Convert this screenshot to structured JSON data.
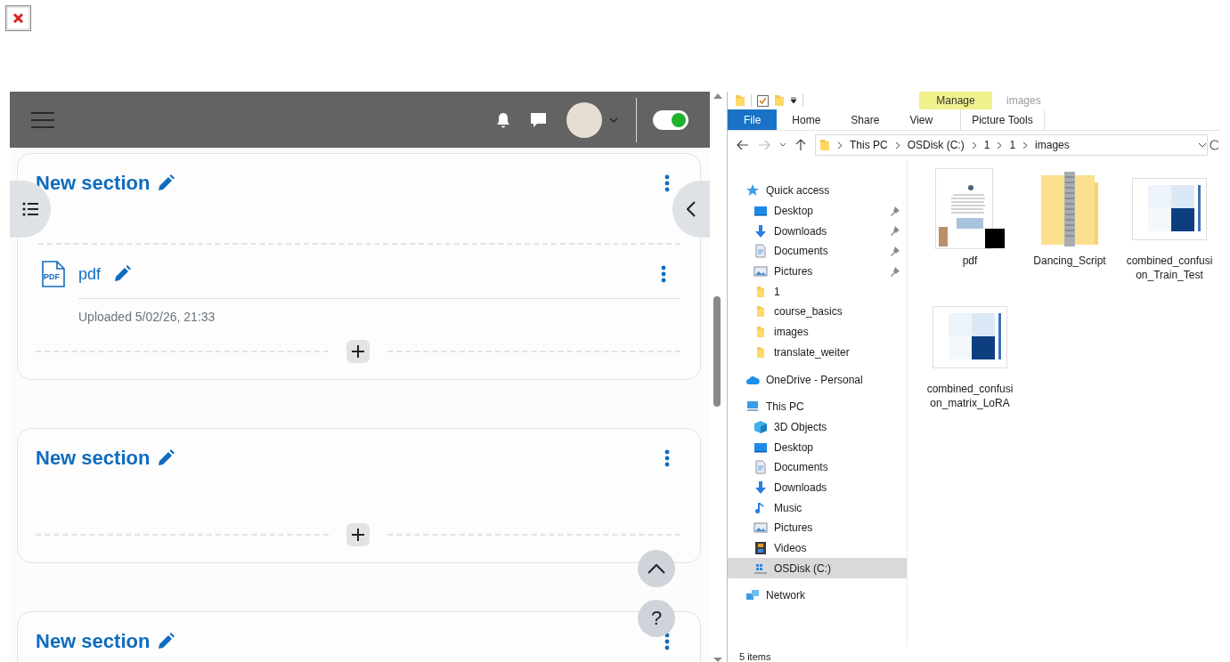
{
  "course": {
    "toggle": {
      "on": true
    },
    "sections": [
      {
        "title": "New section",
        "activities": [
          {
            "kind": "pdf",
            "icon_label": "PDF",
            "name": "pdf",
            "meta": "Uploaded 5/02/26, 21:33"
          }
        ]
      },
      {
        "title": "New section"
      },
      {
        "title": "New section"
      }
    ],
    "help_button": "?"
  },
  "explorer": {
    "contextual_group": "Manage",
    "window_title": "images",
    "ribbon_tabs": [
      {
        "label": "File",
        "kind": "file"
      },
      {
        "label": "Home",
        "kind": "tab"
      },
      {
        "label": "Share",
        "kind": "tab"
      },
      {
        "label": "View",
        "kind": "tab"
      },
      {
        "label": "Picture Tools",
        "kind": "contextual"
      }
    ],
    "path": [
      "This PC",
      "OSDisk (C:)",
      "1",
      "1",
      "images"
    ],
    "nav": [
      {
        "label": "Quick access",
        "selected": false,
        "children": [
          {
            "label": "Desktop",
            "pinned": true,
            "selected": false
          },
          {
            "label": "Downloads",
            "pinned": true,
            "selected": false
          },
          {
            "label": "Documents",
            "pinned": true,
            "selected": false
          },
          {
            "label": "Pictures",
            "pinned": true,
            "selected": false
          },
          {
            "label": "1",
            "pinned": false,
            "selected": false
          },
          {
            "label": "course_basics",
            "pinned": false,
            "selected": false
          },
          {
            "label": "images",
            "pinned": false,
            "selected": false
          },
          {
            "label": "translate_weiter",
            "pinned": false,
            "selected": false
          }
        ]
      },
      {
        "label": "OneDrive - Personal",
        "selected": false
      },
      {
        "label": "This PC",
        "selected": false,
        "children": [
          {
            "label": "3D Objects",
            "pinned": false,
            "selected": false
          },
          {
            "label": "Desktop",
            "pinned": false,
            "selected": false
          },
          {
            "label": "Documents",
            "pinned": false,
            "selected": false
          },
          {
            "label": "Downloads",
            "pinned": false,
            "selected": false
          },
          {
            "label": "Music",
            "pinned": false,
            "selected": false
          },
          {
            "label": "Pictures",
            "pinned": false,
            "selected": false
          },
          {
            "label": "Videos",
            "pinned": false,
            "selected": false
          },
          {
            "label": "OSDisk (C:)",
            "pinned": false,
            "selected": true
          }
        ]
      },
      {
        "label": "Network",
        "selected": false
      }
    ],
    "files": [
      {
        "name": "pdf",
        "kind": "document"
      },
      {
        "name": "Dancing_Script",
        "kind": "zip"
      },
      {
        "name": "combined_confusion_Train_Test",
        "kind": "chart"
      },
      {
        "name": "combined_confusion_matrix_LoRA",
        "kind": "chart"
      }
    ],
    "status": "5 items"
  }
}
